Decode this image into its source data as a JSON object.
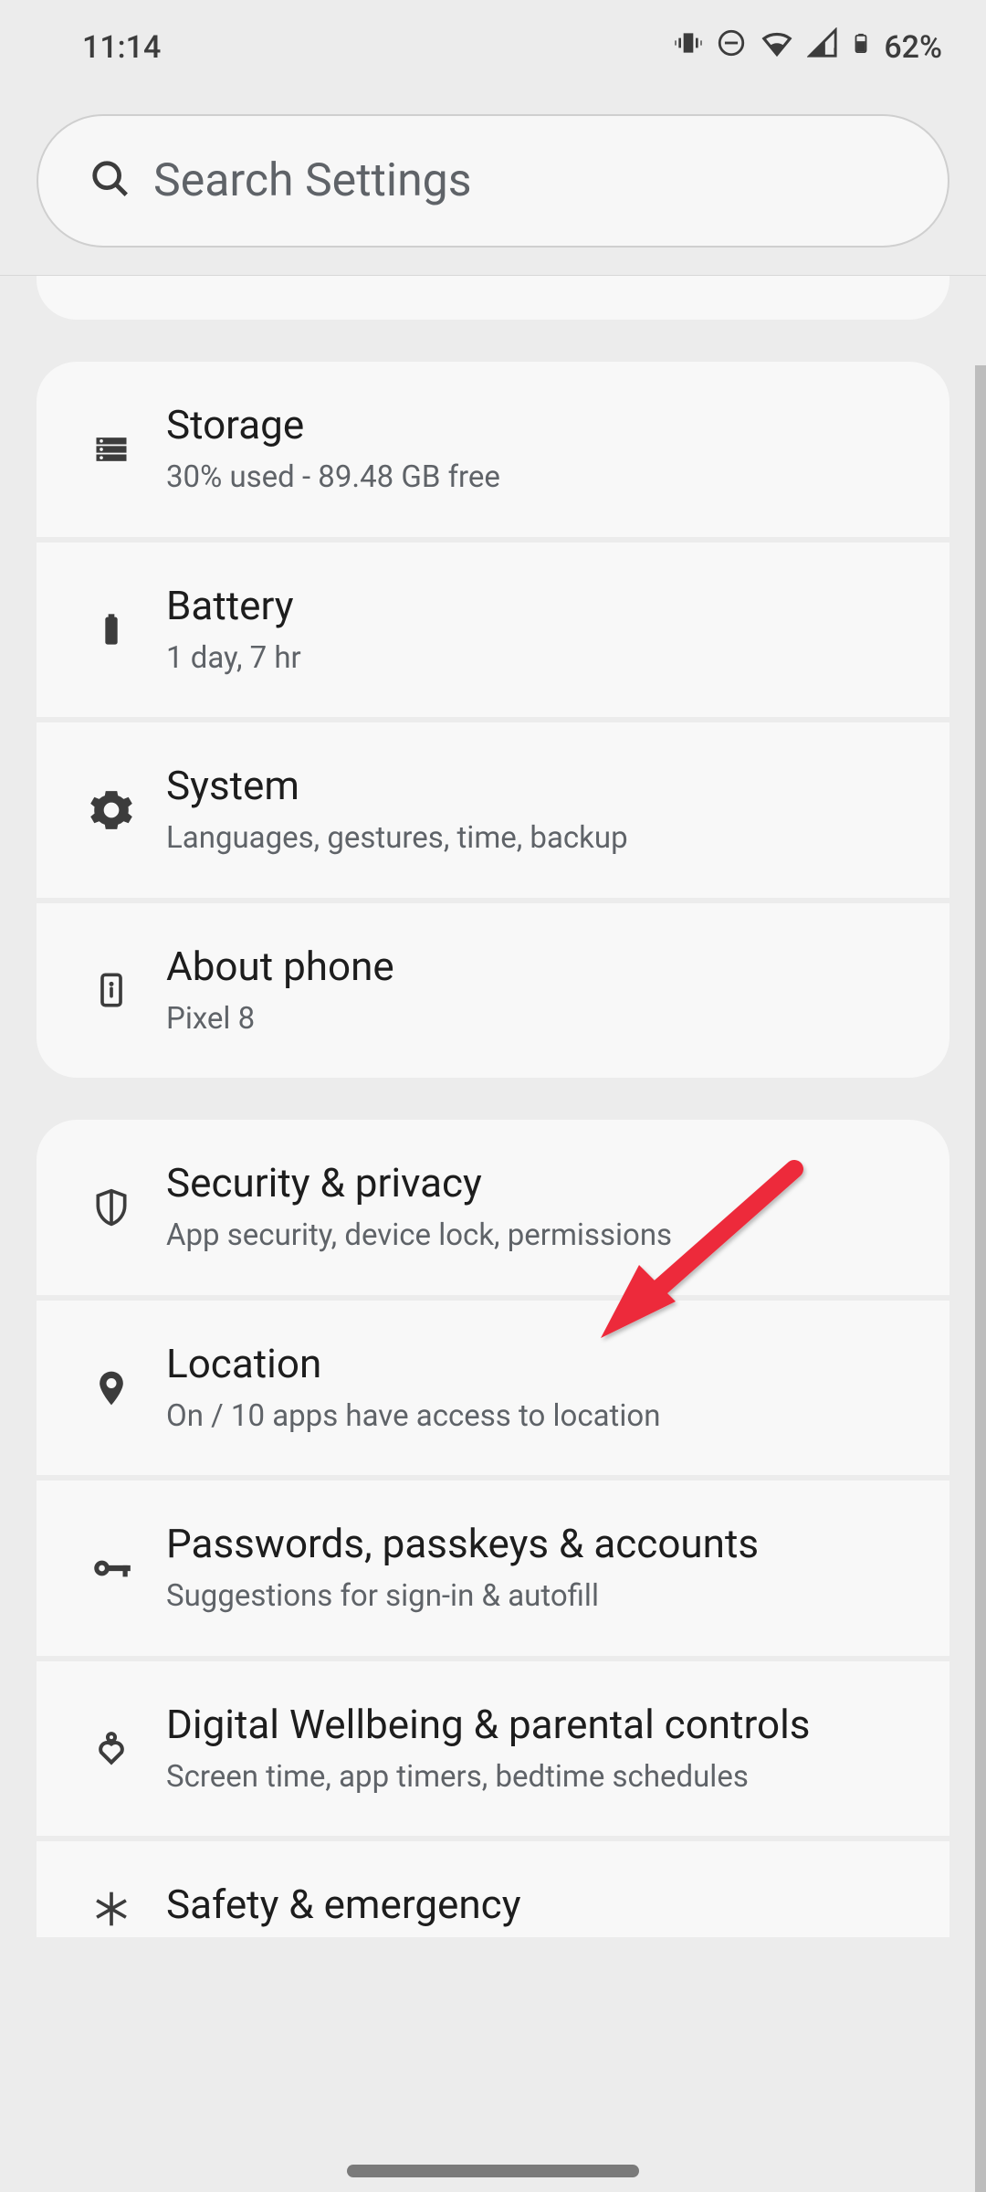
{
  "status": {
    "time": "11:14",
    "battery_pct": "62%"
  },
  "search": {
    "placeholder": "Search Settings"
  },
  "groups": [
    {
      "items": [
        {
          "key": "storage",
          "icon": "storage-icon",
          "title": "Storage",
          "subtitle": "30% used - 89.48 GB free"
        },
        {
          "key": "battery",
          "icon": "battery-icon",
          "title": "Battery",
          "subtitle": "1 day, 7 hr"
        },
        {
          "key": "system",
          "icon": "gear-icon",
          "title": "System",
          "subtitle": "Languages, gestures, time, backup"
        },
        {
          "key": "about",
          "icon": "phone-info-icon",
          "title": "About phone",
          "subtitle": "Pixel 8"
        }
      ]
    },
    {
      "items": [
        {
          "key": "security",
          "icon": "shield-icon",
          "title": "Security & privacy",
          "subtitle": "App security, device lock, permissions"
        },
        {
          "key": "location",
          "icon": "location-icon",
          "title": "Location",
          "subtitle": "On / 10 apps have access to location"
        },
        {
          "key": "passwords",
          "icon": "key-icon",
          "title": "Passwords, passkeys & accounts",
          "subtitle": "Suggestions for sign-in & autofill"
        },
        {
          "key": "wellbeing",
          "icon": "wellbeing-icon",
          "title": "Digital Wellbeing & parental controls",
          "subtitle": "Screen time, app timers, bedtime schedules"
        },
        {
          "key": "safety",
          "icon": "asterisk-icon",
          "title": "Safety & emergency",
          "subtitle": ""
        }
      ]
    }
  ],
  "annotation": {
    "type": "arrow",
    "target": "security",
    "color": "#ed2b3a"
  }
}
